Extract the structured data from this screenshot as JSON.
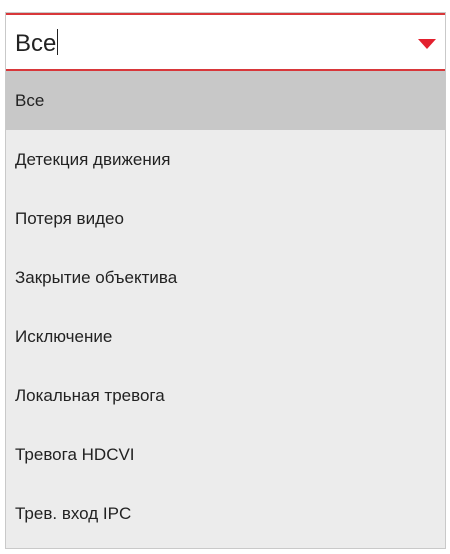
{
  "select": {
    "value": "Все"
  },
  "options": [
    {
      "label": "Все",
      "selected": true
    },
    {
      "label": "Детекция движения",
      "selected": false
    },
    {
      "label": "Потеря видео",
      "selected": false
    },
    {
      "label": "Закрытие объектива",
      "selected": false
    },
    {
      "label": "Исключение",
      "selected": false
    },
    {
      "label": "Локальная тревога",
      "selected": false
    },
    {
      "label": "Тревога HDCVI",
      "selected": false
    },
    {
      "label": "Трев. вход IPC",
      "selected": false
    }
  ],
  "colors": {
    "accent": "#d8373a",
    "arrow": "#e3202e",
    "list_background": "#ececec",
    "selected_background": "#c8c8c8"
  },
  "icons": {
    "dropdown_arrow": "chevron-down-icon"
  }
}
